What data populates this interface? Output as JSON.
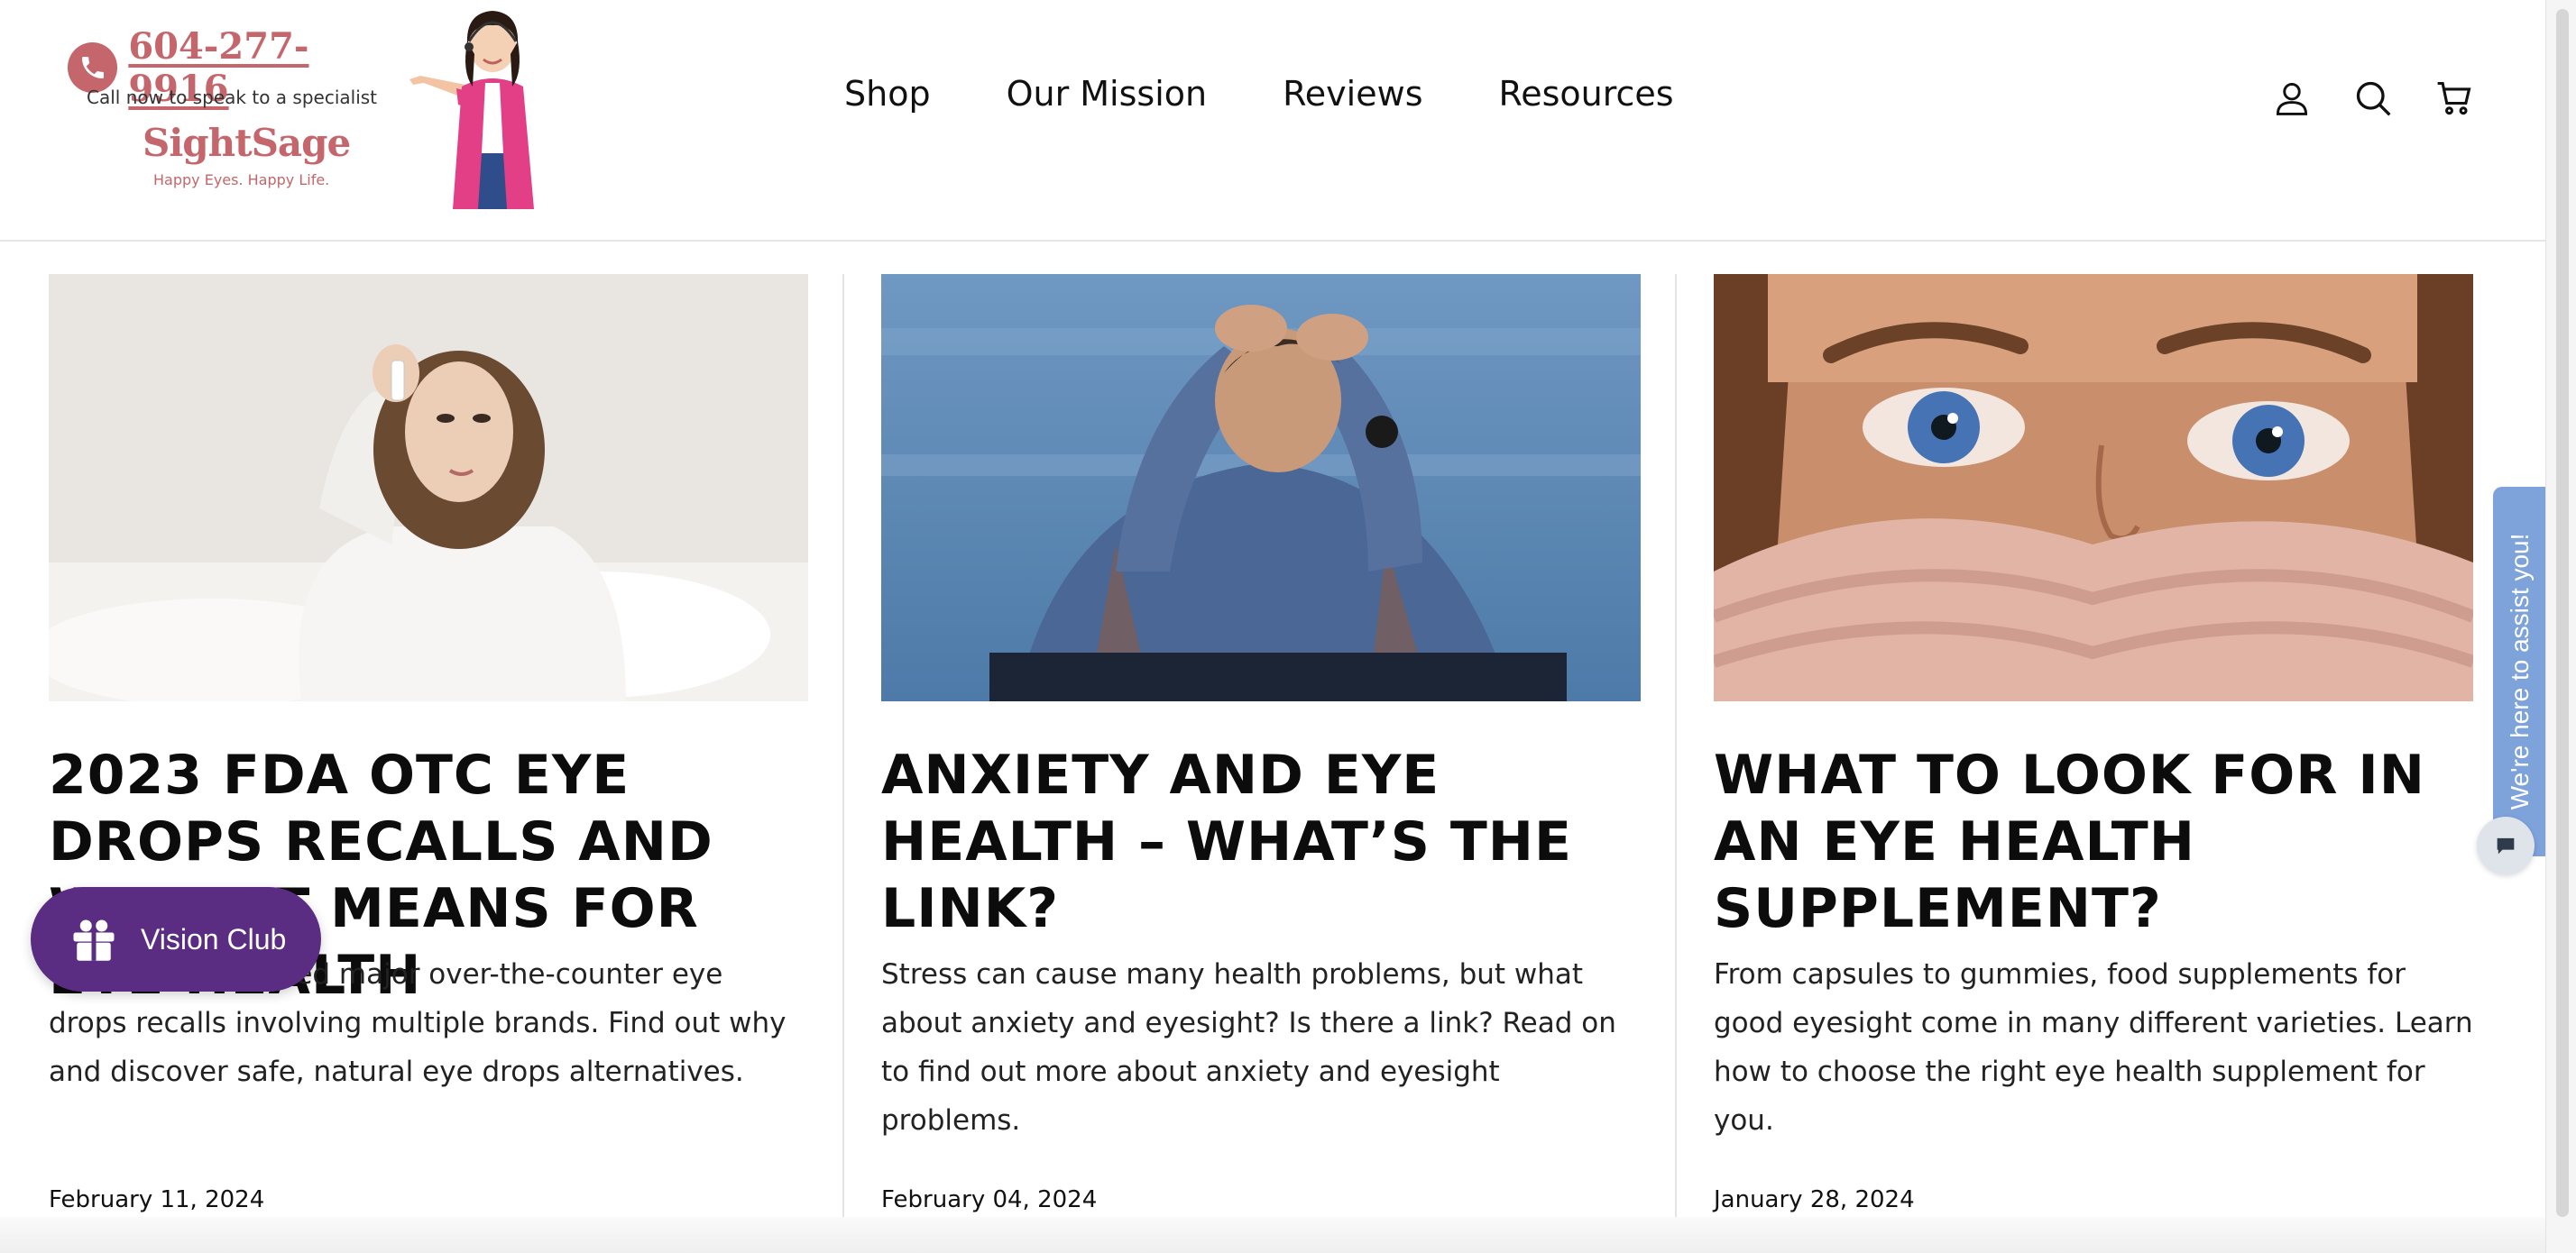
{
  "header": {
    "phone_number": "604-277-9916",
    "call_text": "Call now to speak to a specialist",
    "brand_name": "SightSage",
    "tagline": "Happy Eyes. Happy Life.",
    "nav": [
      {
        "label": "Shop"
      },
      {
        "label": "Our Mission"
      },
      {
        "label": "Reviews"
      },
      {
        "label": "Resources"
      }
    ],
    "icons": [
      "account-icon",
      "search-icon",
      "cart-icon"
    ],
    "brand_color": "#c4666b"
  },
  "articles": [
    {
      "title": "2023 FDA OTC EYE DROPS RECALLS AND WHAT IT MEANS FOR EYE HEALTH",
      "excerpt": "The FDA announced major over-the-counter eye drops recalls involving multiple brands. Find out why and discover safe, natural eye drops alternatives.",
      "date": "February 11, 2024",
      "image": "woman-applying-eye-drops"
    },
    {
      "title": "ANXIETY AND EYE HEALTH – WHAT’S THE LINK?",
      "excerpt": "Stress can cause many health problems, but what about anxiety and eyesight? Is there a link? Read on to find out more about anxiety and eyesight problems.",
      "date": "February 04, 2024",
      "image": "stressed-man-holding-head"
    },
    {
      "title": "WHAT TO LOOK FOR IN AN EYE HEALTH SUPPLEMENT?",
      "excerpt": "From capsules to gummies, food supplements for good eyesight come in many different varieties. Learn how to choose the right eye health supplement for you.",
      "date": "January 28, 2024",
      "image": "blue-eyes-close-up"
    }
  ],
  "vision_club": {
    "label": "Vision Club",
    "color": "#5a2d82"
  },
  "assist": {
    "label": "We're here to assist you!",
    "color": "#7ea2da"
  }
}
